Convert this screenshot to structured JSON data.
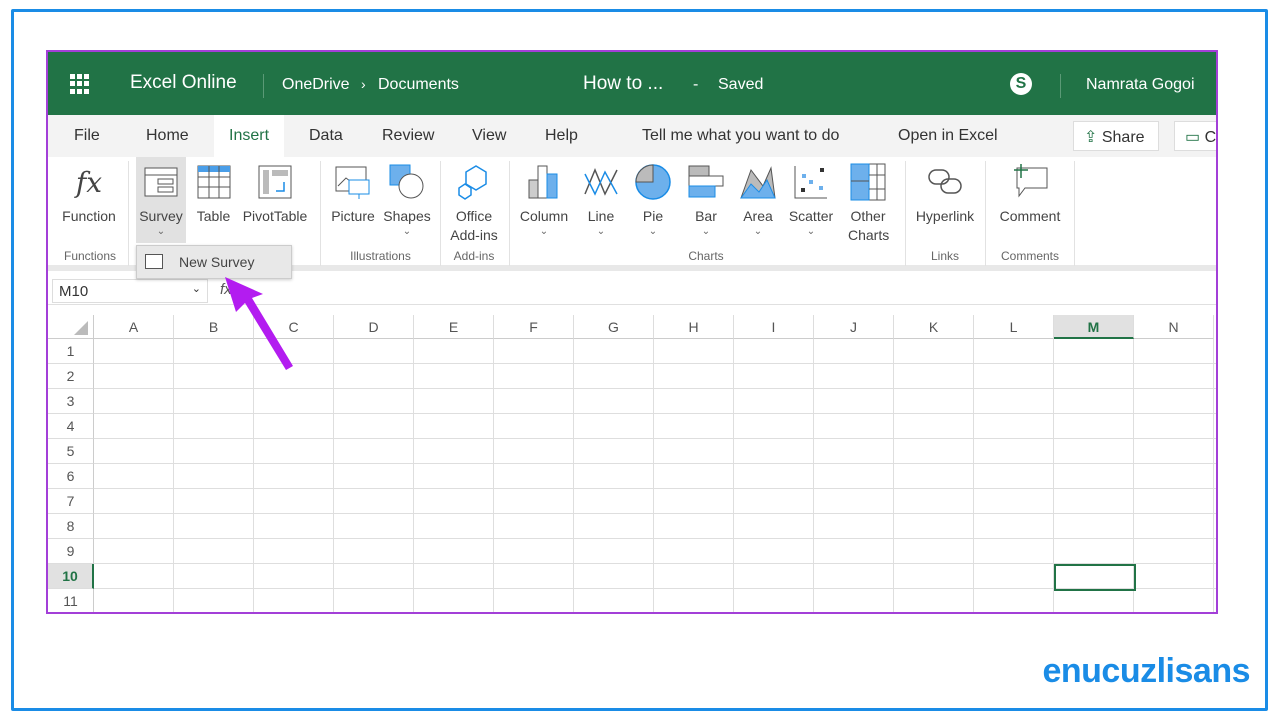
{
  "header": {
    "app_name": "Excel Online",
    "breadcrumb": [
      "OneDrive",
      "Documents"
    ],
    "doc_title": "How to ...",
    "separator": "-",
    "status": "Saved",
    "user": "Namrata Gogoi"
  },
  "tabs": [
    "File",
    "Home",
    "Insert",
    "Data",
    "Review",
    "View",
    "Help"
  ],
  "active_tab": "Insert",
  "tell_me": "Tell me what you want to do",
  "open_in_excel": "Open in Excel",
  "share": "Share",
  "comments_btn": "C",
  "ribbon": {
    "buttons": [
      {
        "label": "Function"
      },
      {
        "label": "Survey"
      },
      {
        "label": "Table"
      },
      {
        "label": "PivotTable"
      },
      {
        "label": "Picture"
      },
      {
        "label": "Shapes"
      },
      {
        "label": "Office Add-ins"
      },
      {
        "label": "Column"
      },
      {
        "label": "Line"
      },
      {
        "label": "Pie"
      },
      {
        "label": "Bar"
      },
      {
        "label": "Area"
      },
      {
        "label": "Scatter"
      },
      {
        "label": "Other Charts"
      },
      {
        "label": "Hyperlink"
      },
      {
        "label": "Comment"
      }
    ],
    "groups": [
      "Functions",
      "Illustrations",
      "Add-ins",
      "Charts",
      "Links",
      "Comments"
    ]
  },
  "dropdown": {
    "item": "New Survey"
  },
  "formula_bar": {
    "name_box": "M10",
    "fx": "fx"
  },
  "grid": {
    "columns": [
      "A",
      "B",
      "C",
      "D",
      "E",
      "F",
      "G",
      "H",
      "I",
      "J",
      "K",
      "L",
      "M",
      "N"
    ],
    "rows": [
      "1",
      "2",
      "3",
      "4",
      "5",
      "6",
      "7",
      "8",
      "9",
      "10",
      "11"
    ],
    "selected_cell": "M10"
  },
  "watermark": "enucuzlisans",
  "colors": {
    "excel_green": "#217346",
    "frame_blue": "#1a8ce6",
    "border_purple": "#a33fd8",
    "arrow": "#b31cf0"
  }
}
